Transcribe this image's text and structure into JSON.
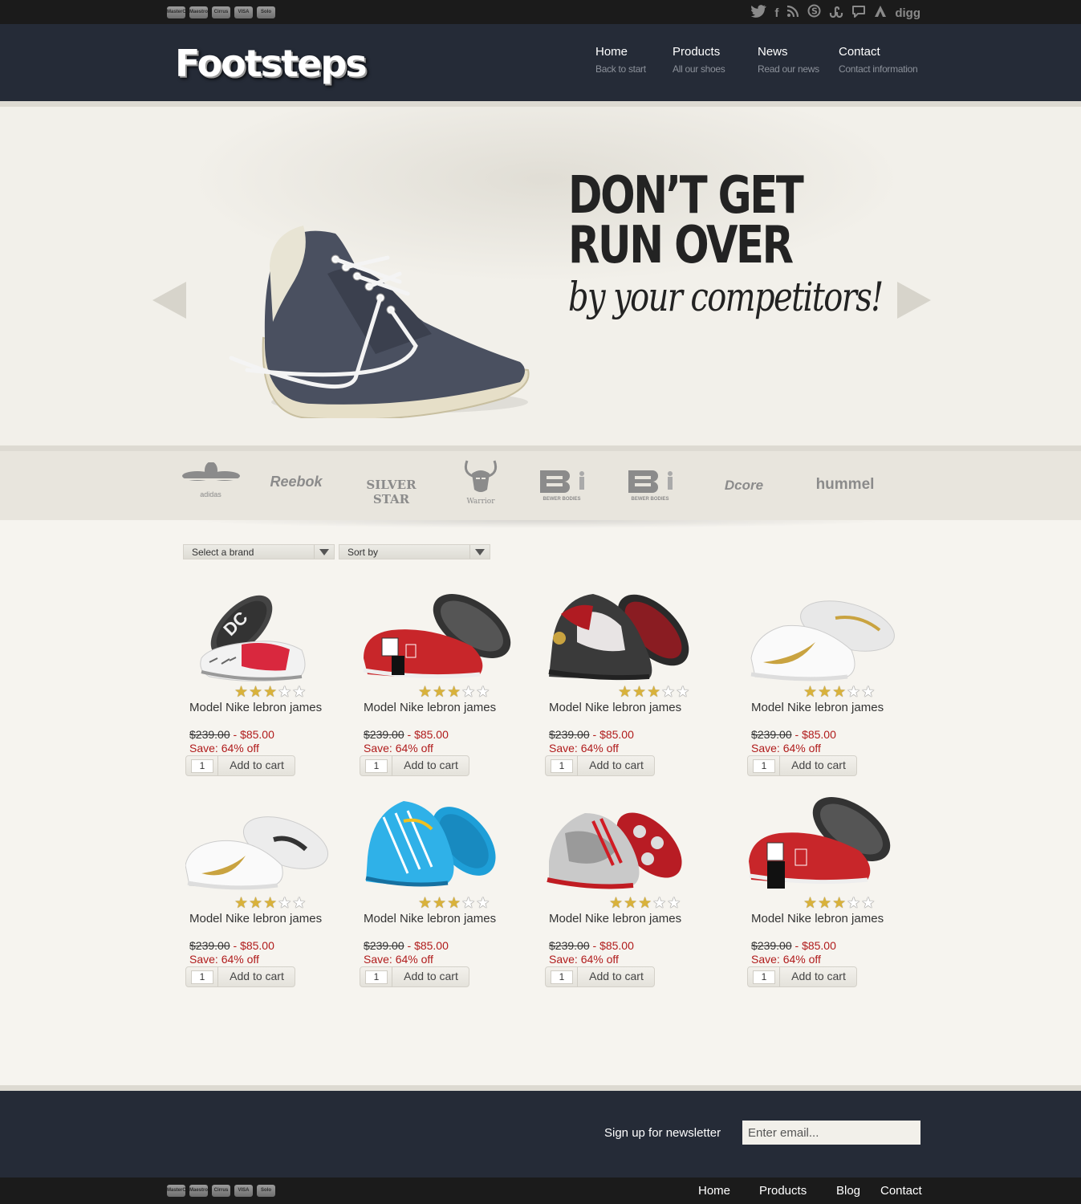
{
  "payment_icons": [
    "MasterCard",
    "Maestro",
    "Cirrus",
    "VISA",
    "Solo"
  ],
  "social_icons": [
    "twitter-icon",
    "facebook-icon",
    "rss-icon",
    "skype-icon",
    "stumbleupon-icon",
    "chat-icon",
    "delicious-icon",
    "digg-icon"
  ],
  "social_labels": {
    "digg": "digg"
  },
  "header": {
    "logo": "Footsteps",
    "nav": [
      {
        "title": "Home",
        "subtitle": "Back to start"
      },
      {
        "title": "Products",
        "subtitle": "All our shoes"
      },
      {
        "title": "News",
        "subtitle": "Read our news"
      },
      {
        "title": "Contact",
        "subtitle": "Contact information"
      }
    ]
  },
  "hero": {
    "line1": "DON’T GET",
    "line2": "RUN OVER",
    "line3": "by your competitors!"
  },
  "brands": [
    "adidas",
    "Reebok",
    "SILVER STAR",
    "Warrior",
    "BEWER BODIES",
    "BEWER BODIES",
    "Dcore",
    "hummel"
  ],
  "filters": {
    "brand": "Select a brand",
    "sort": "Sort by"
  },
  "products": [
    {
      "name": "Model Nike lebron james",
      "old_price": "$239.00",
      "sep": " - ",
      "new_price": "$85.00",
      "save": "Save: 64% off",
      "qty": "1",
      "cart": "Add to cart",
      "rating": 3
    },
    {
      "name": "Model Nike lebron james",
      "old_price": "$239.00",
      "sep": " - ",
      "new_price": "$85.00",
      "save": "Save: 64% off",
      "qty": "1",
      "cart": "Add to cart",
      "rating": 3
    },
    {
      "name": "Model Nike lebron james",
      "old_price": "$239.00",
      "sep": " - ",
      "new_price": "$85.00",
      "save": "Save: 64% off",
      "qty": "1",
      "cart": "Add to cart",
      "rating": 3
    },
    {
      "name": "Model Nike lebron james",
      "old_price": "$239.00",
      "sep": " - ",
      "new_price": "$85.00",
      "save": "Save: 64% off",
      "qty": "1",
      "cart": "Add to cart",
      "rating": 3
    },
    {
      "name": "Model Nike lebron james",
      "old_price": "$239.00",
      "sep": " - ",
      "new_price": "$85.00",
      "save": "Save: 64% off",
      "qty": "1",
      "cart": "Add to cart",
      "rating": 3
    },
    {
      "name": "Model Nike lebron james",
      "old_price": "$239.00",
      "sep": " - ",
      "new_price": "$85.00",
      "save": "Save: 64% off",
      "qty": "1",
      "cart": "Add to cart",
      "rating": 3
    },
    {
      "name": "Model Nike lebron james",
      "old_price": "$239.00",
      "sep": " - ",
      "new_price": "$85.00",
      "save": "Save: 64% off",
      "qty": "1",
      "cart": "Add to cart",
      "rating": 3
    },
    {
      "name": "Model Nike lebron james",
      "old_price": "$239.00",
      "sep": " - ",
      "new_price": "$85.00",
      "save": "Save: 64% off",
      "qty": "1",
      "cart": "Add to cart",
      "rating": 3
    }
  ],
  "newsletter": {
    "label": "Sign up for newsletter",
    "placeholder": "Enter email..."
  },
  "footer_nav": [
    "Home",
    "Products",
    "Blog",
    "Contact"
  ],
  "colors": {
    "header_bg": "#252b37",
    "topbar_bg": "#1b1b1b",
    "page_bg": "#f6f4ef",
    "price_red": "#b01b1b"
  }
}
